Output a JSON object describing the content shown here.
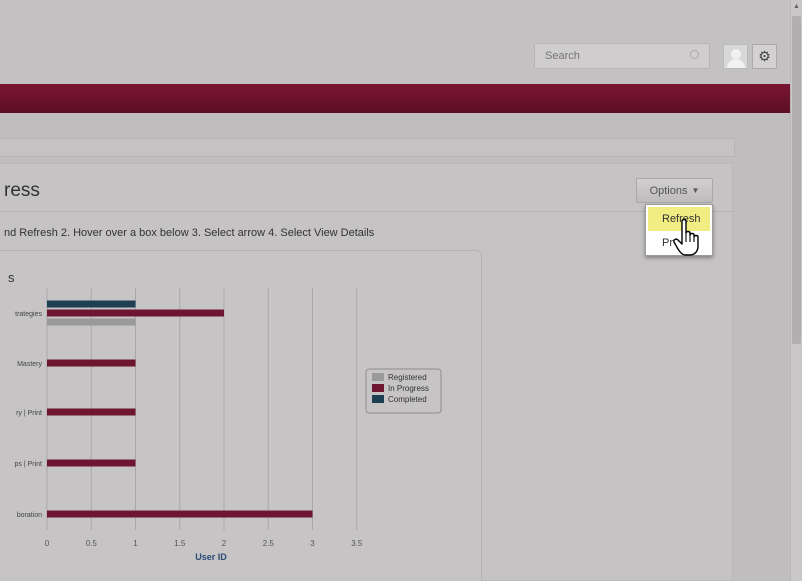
{
  "header": {
    "search_placeholder": "Search",
    "search_icon": "magnifier-icon",
    "avatar_icon": "user-avatar-icon",
    "settings_icon": "gear-icon"
  },
  "colors": {
    "banner": "#6b1230",
    "registered": "#9b9a9b",
    "in_progress": "#6e1631",
    "completed": "#1e3f52",
    "menu_highlight": "#f1ed83"
  },
  "panel": {
    "title": "ress",
    "instructions": "nd Refresh 2. Hover over a box below 3. Select arrow 4. Select View Details",
    "options_label": "Options",
    "options_caret": "▼"
  },
  "options_menu": {
    "items": [
      "Refresh",
      "Pr"
    ],
    "highlighted_index": 0
  },
  "chart_data": {
    "type": "bar",
    "orientation": "horizontal",
    "title": "s",
    "xlabel": "User ID",
    "xlim": [
      0,
      3.5
    ],
    "xticks": [
      "0",
      "0.5",
      "1",
      "1.5",
      "2",
      "2.5",
      "3",
      "3.5"
    ],
    "categories": [
      "trategies",
      "Mastery",
      "ry | Print",
      "ps | Print",
      "boration"
    ],
    "series": [
      {
        "name": "Registered",
        "color": "#9b9a9b",
        "values": [
          1,
          0,
          0,
          0,
          0
        ]
      },
      {
        "name": "In Progress",
        "color": "#6e1631",
        "values": [
          2,
          1,
          1,
          1,
          3
        ]
      },
      {
        "name": "Completed",
        "color": "#1e3f52",
        "values": [
          1,
          0,
          0,
          0,
          0
        ]
      }
    ],
    "grid": true,
    "legend": "right"
  }
}
